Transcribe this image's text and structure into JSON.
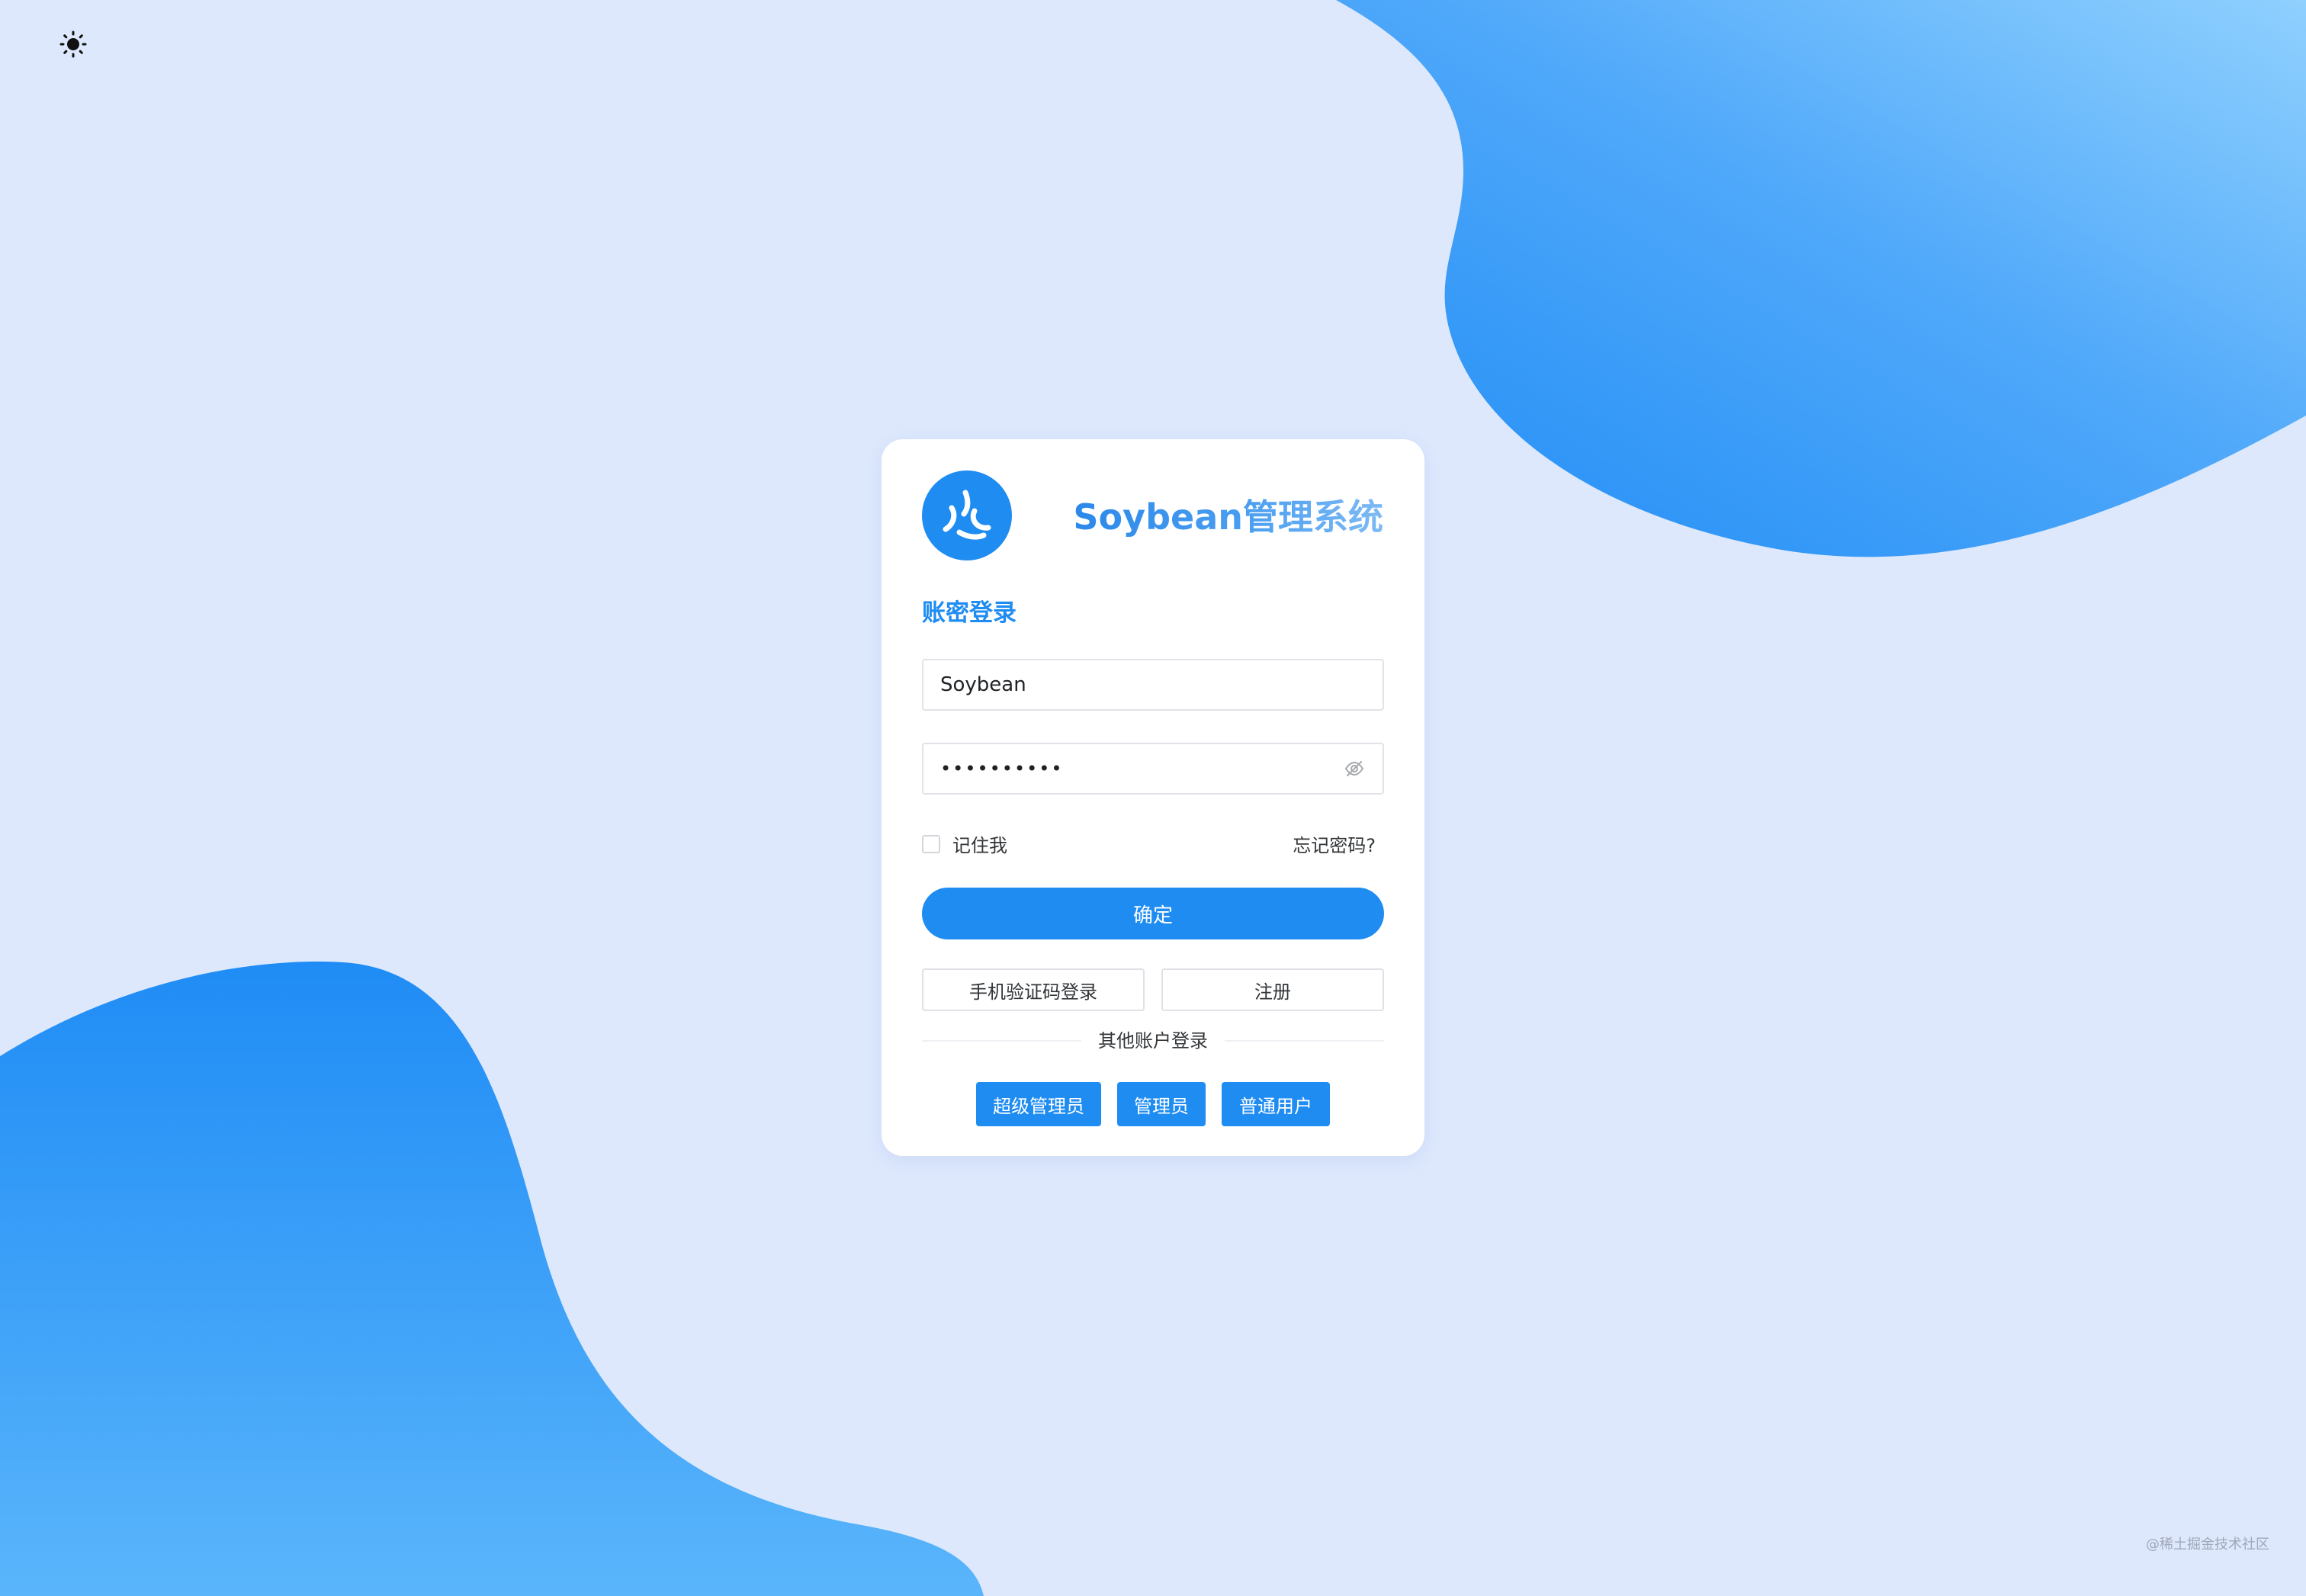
{
  "colors": {
    "background": "#dde8fd",
    "primary": "#1f8cf2",
    "card": "#ffffff"
  },
  "theme_toggle": {
    "icon": "sun-icon"
  },
  "header": {
    "logo_icon": "soybean-logo-icon",
    "title": "Soybean管理系统"
  },
  "form": {
    "section_title": "账密登录",
    "username_value": "Soybean",
    "password_value": "soybean123",
    "password_toggle_icon": "eye-off-icon",
    "remember_label": "记住我",
    "forgot_label": "忘记密码?",
    "confirm_label": "确定",
    "phone_login_label": "手机验证码登录",
    "register_label": "注册"
  },
  "other_login": {
    "divider_label": "其他账户登录",
    "accounts": [
      "超级管理员",
      "管理员",
      "普通用户"
    ]
  },
  "watermark": "@稀土掘金技术社区"
}
